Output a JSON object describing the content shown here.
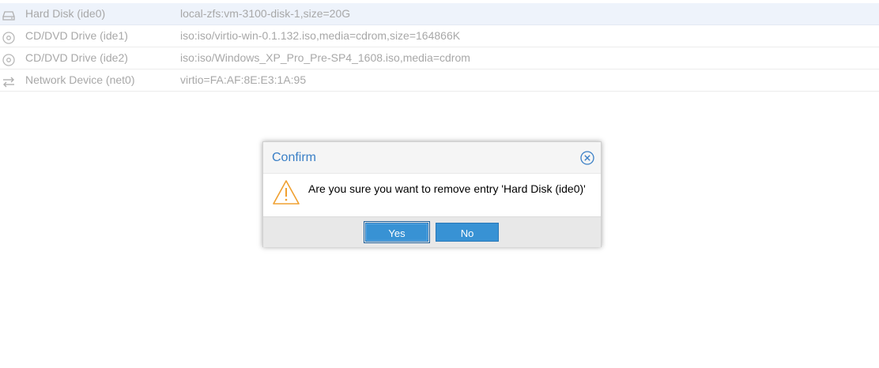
{
  "grid": {
    "rows": [
      {
        "icon": "hard-disk-icon",
        "name": "Hard Disk (ide0)",
        "value": "local-zfs:vm-3100-disk-1,size=20G",
        "selected": true
      },
      {
        "icon": "cdrom-icon",
        "name": "CD/DVD Drive (ide1)",
        "value": "iso:iso/virtio-win-0.1.132.iso,media=cdrom,size=164866K",
        "selected": false
      },
      {
        "icon": "cdrom-icon",
        "name": "CD/DVD Drive (ide2)",
        "value": "iso:iso/Windows_XP_Pro_Pre-SP4_1608.iso,media=cdrom",
        "selected": false
      },
      {
        "icon": "network-exchange-icon",
        "name": "Network Device (net0)",
        "value": "virtio=FA:AF:8E:E3:1A:95",
        "selected": false
      }
    ]
  },
  "dialog": {
    "title": "Confirm",
    "message": "Are you sure you want to remove entry 'Hard Disk (ide0)'",
    "yes_label": "Yes",
    "no_label": "No",
    "icons": {
      "close": "close-circle-icon",
      "warning": "warning-triangle-icon"
    }
  },
  "colors": {
    "accent": "#3892d4",
    "title": "#3a7fc6",
    "selected_row": "#eef3fb",
    "muted_text": "#a8a8a8",
    "warning": "#f0a030"
  }
}
